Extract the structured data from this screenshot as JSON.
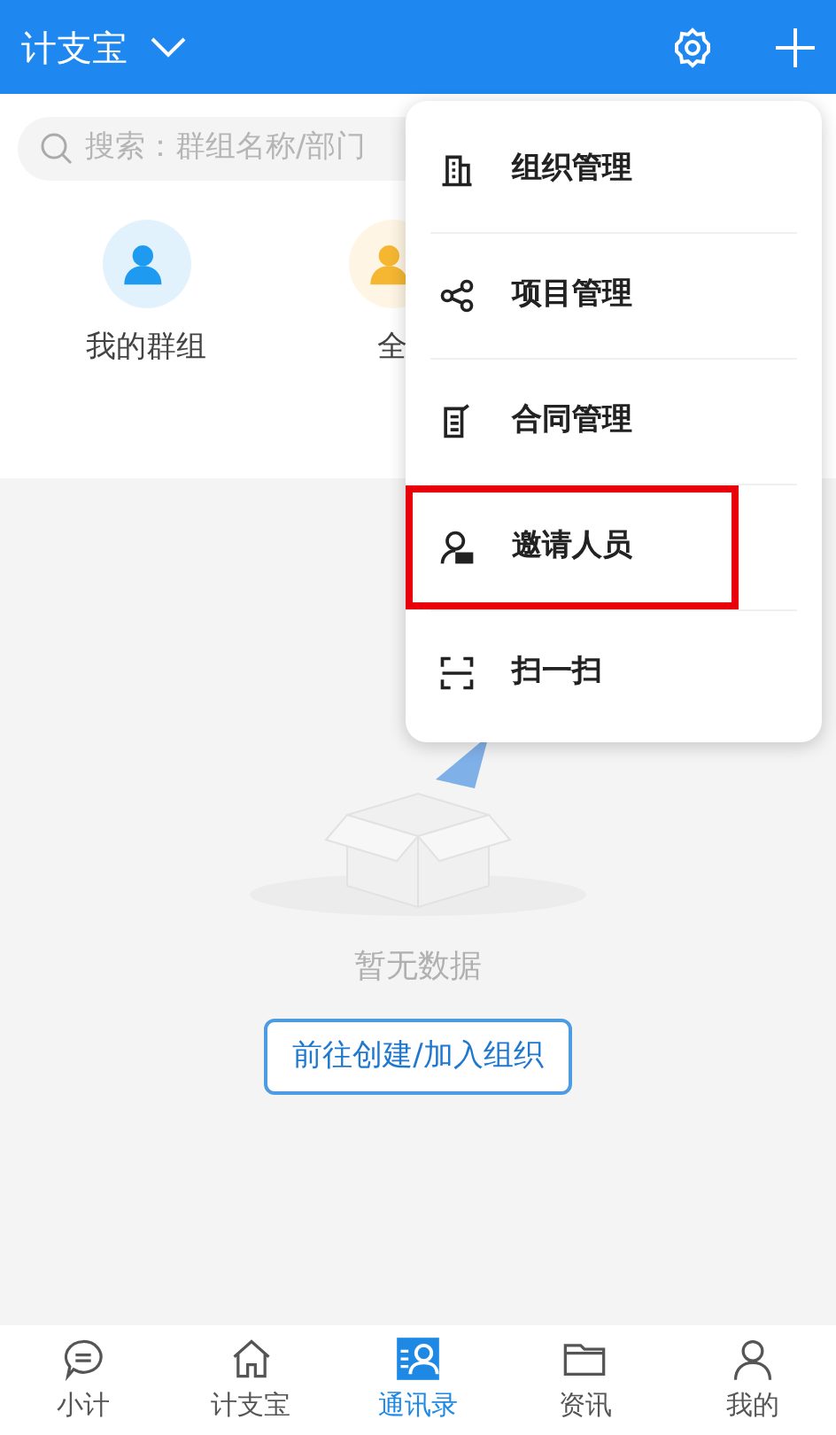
{
  "header": {
    "title": "计支宝"
  },
  "search": {
    "placeholder": "搜索：群组名称/部门"
  },
  "quick_items": [
    {
      "label": "我的群组",
      "color": "#1e9af0"
    },
    {
      "label": "全",
      "color": "#f5b731"
    }
  ],
  "empty_state": {
    "message": "暂无数据",
    "button": "前往创建/加入组织"
  },
  "menu": [
    {
      "kind": "building",
      "label": "组织管理",
      "highlighted": false
    },
    {
      "kind": "share",
      "label": "项目管理",
      "highlighted": false
    },
    {
      "kind": "contract",
      "label": "合同管理",
      "highlighted": false
    },
    {
      "kind": "invite",
      "label": "邀请人员",
      "highlighted": true
    },
    {
      "kind": "scan",
      "label": "扫一扫",
      "highlighted": false
    }
  ],
  "tabs": [
    {
      "kind": "chat",
      "label": "小计",
      "selected": false
    },
    {
      "kind": "home",
      "label": "计支宝",
      "selected": false
    },
    {
      "kind": "contacts",
      "label": "通讯录",
      "selected": true
    },
    {
      "kind": "folder",
      "label": "资讯",
      "selected": false
    },
    {
      "kind": "person",
      "label": "我的",
      "selected": false
    }
  ]
}
